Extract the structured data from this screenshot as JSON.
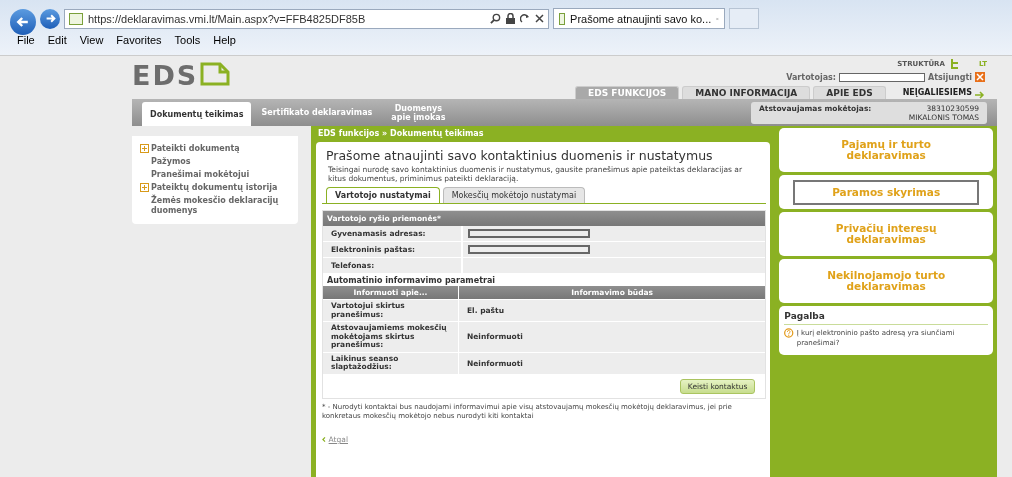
{
  "browser": {
    "url": "https://deklaravimas.vmi.lt/Main.aspx?v=FFB4825DF85B",
    "tab_title": "Prašome atnaujinti savo ko...",
    "menu": [
      "File",
      "Edit",
      "View",
      "Favorites",
      "Tools",
      "Help"
    ]
  },
  "header": {
    "logo": "EDS",
    "structure_link": "STRUKTŪRA",
    "language": "LT",
    "user_label": "Vartotojas:",
    "logout": "Atsijungti",
    "top_tabs": [
      {
        "label": "EDS FUNKCIJOS",
        "selected": true
      },
      {
        "label": "MANO INFORMACIJA",
        "selected": false
      },
      {
        "label": "APIE EDS",
        "selected": false
      }
    ],
    "accessibility_link": "NEĮGALIESIEMS"
  },
  "nav_tabs": [
    {
      "label": "Dokumentų teikimas",
      "selected": true
    },
    {
      "label": "Sertifikato deklaravimas",
      "selected": false
    },
    {
      "label": "Duomenys apie įmokas",
      "selected": false
    }
  ],
  "represented": {
    "label": "Atstovaujamas mokėtojas:",
    "code": "38310230599",
    "name": "MIKALONIS TOMAS"
  },
  "sidebar": {
    "items": [
      {
        "label": "Pateikti dokumentą",
        "expandable": true
      },
      {
        "label": "Pažymos",
        "expandable": false
      },
      {
        "label": "Pranešimai mokėtojui",
        "expandable": false
      },
      {
        "label": "Pateiktų dokumentų istorija",
        "expandable": true
      },
      {
        "label": "Žemės mokesčio deklaracijų duomenys",
        "expandable": false
      }
    ]
  },
  "breadcrumb": "EDS funkcijos » Dokumentų teikimas",
  "main": {
    "title": "Prašome atnaujinti savo kontaktinius duomenis ir nustatymus",
    "intro": "Teisingai nurodę savo kontaktinius duomenis ir nustatymus, gausite pranešimus apie pateiktas deklaracijas ar kitus dokumentus, priminimus pateikti deklaraciją.",
    "tabs": [
      {
        "label": "Vartotojo nustatymai",
        "selected": true
      },
      {
        "label": "Mokesčių mokėtojo nustatymai",
        "selected": false
      }
    ],
    "contacts": {
      "title": "Vartotojo ryšio priemonės*",
      "fields": [
        {
          "label": "Gyvenamasis adresas:",
          "kind": "input"
        },
        {
          "label": "Elektroninis paštas:",
          "kind": "input"
        },
        {
          "label": "Telefonas:",
          "kind": "empty"
        }
      ]
    },
    "notifications": {
      "title": "Automatinio informavimo parametrai",
      "columns": [
        "Informuoti apie...",
        "Informavimo būdas"
      ],
      "rows": [
        {
          "topic": "Vartotojui skirtus pranešimus:",
          "method": "El. paštu"
        },
        {
          "topic": "Atstovaujamiems mokesčių mokėtojams skirtus pranešimus:",
          "method": "Neinformuoti"
        },
        {
          "topic": "Laikinus seanso slaptažodžius:",
          "method": "Neinformuoti"
        }
      ],
      "button": "Keisti kontaktus"
    },
    "footnote": "* - Nurodyti kontaktai bus naudojami informavimui apie visų atstovaujamų mokesčių mokėtojų deklaravimus, jei prie konkretaus mokesčių mokėtojo nebus nurodyti kiti kontaktai",
    "back_link": "Atgal"
  },
  "right_cards": [
    {
      "label": "Pajamų ir turto deklaravimas",
      "focused": false
    },
    {
      "label": "Paramos skyrimas",
      "focused": true
    },
    {
      "label": "Privačių interesų deklaravimas",
      "focused": false
    },
    {
      "label": "Nekilnojamojo turto deklaravimas",
      "focused": false
    }
  ],
  "help": {
    "title": "Pagalba",
    "question": "Į kurį elektroninio pašto adresą yra siunčiami pranešimai?"
  }
}
